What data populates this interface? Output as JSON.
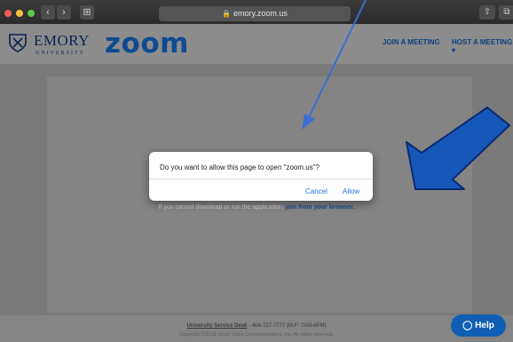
{
  "browser": {
    "url": "emory.zoom.us",
    "back_glyph": "‹",
    "forward_glyph": "›",
    "sidebar_glyph": "⊞",
    "share_glyph": "⇧",
    "tabs_glyph": "⧉"
  },
  "header": {
    "emory_name": "EMORY",
    "emory_sub": "UNIVERSITY",
    "zoom_logo": "zoom",
    "nav": {
      "join": "JOIN A MEETING",
      "host": "HOST A MEETING ▾"
    }
  },
  "dialog": {
    "message": "Do you want to allow this page to open \"zoom.us\"?",
    "cancel_label": "Cancel",
    "allow_label": "Allow"
  },
  "content": {
    "helper_prefix": "If you cannot download or run the application,",
    "helper_link": "join from your browser."
  },
  "footer": {
    "line1_link": "University Service Desk",
    "line1_rest": " - 404-727-7777 (M-F: 7AM-6PM)",
    "line2": "Copyright ©2018 Zoom Video Communications, Inc. All rights reserved."
  },
  "help_button": {
    "label": "Help",
    "icon": "chat-bubble-icon"
  },
  "annotations": {
    "arrow_color_thin": "#3a6fd0",
    "arrow_color_thick": "#1657b8"
  }
}
